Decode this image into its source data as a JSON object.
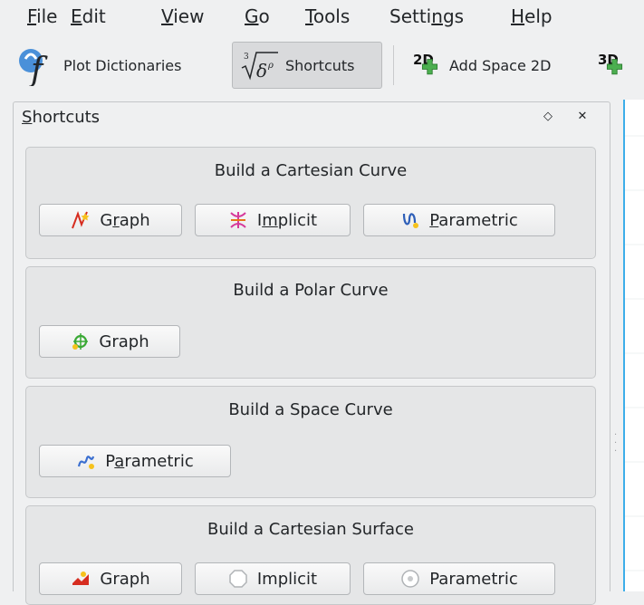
{
  "menubar": {
    "items": [
      {
        "pre": "",
        "key": "F",
        "post": "ile"
      },
      {
        "pre": "",
        "key": "E",
        "post": "dit"
      },
      {
        "pre": "",
        "key": "V",
        "post": "iew"
      },
      {
        "pre": "",
        "key": "G",
        "post": "o"
      },
      {
        "pre": "",
        "key": "T",
        "post": "ools"
      },
      {
        "pre": "Setti",
        "key": "n",
        "post": "gs"
      },
      {
        "pre": "",
        "key": "H",
        "post": "elp"
      }
    ]
  },
  "toolbar": {
    "plot_dictionaries": "Plot Dictionaries",
    "shortcuts": "Shortcuts",
    "add_space_2d": "Add Space 2D",
    "badge_2d": "2D",
    "badge_3d": "3D"
  },
  "dock": {
    "title_key": "S",
    "title_rest": "hortcuts",
    "float_symbol": "◇",
    "close_symbol": "✕"
  },
  "groups": {
    "cartesian_curve": {
      "title": "Build a Cartesian Curve",
      "graph": {
        "pre": "G",
        "key": "r",
        "post": "aph"
      },
      "implicit": {
        "pre": "I",
        "key": "m",
        "post": "plicit"
      },
      "parametric": {
        "pre": "",
        "key": "P",
        "post": "arametric"
      }
    },
    "polar_curve": {
      "title": "Build a Polar Curve",
      "graph": "Graph"
    },
    "space_curve": {
      "title": "Build a Space Curve",
      "parametric": {
        "pre": "P",
        "key": "a",
        "post": "rametric"
      }
    },
    "cartesian_surface": {
      "title": "Build a Cartesian Surface",
      "graph": "Graph",
      "implicit": "Implicit",
      "parametric": "Parametric"
    }
  },
  "colors": {
    "accent": "#3daee9",
    "window": "#eff0f1",
    "group_bg": "#e5e6e7"
  }
}
